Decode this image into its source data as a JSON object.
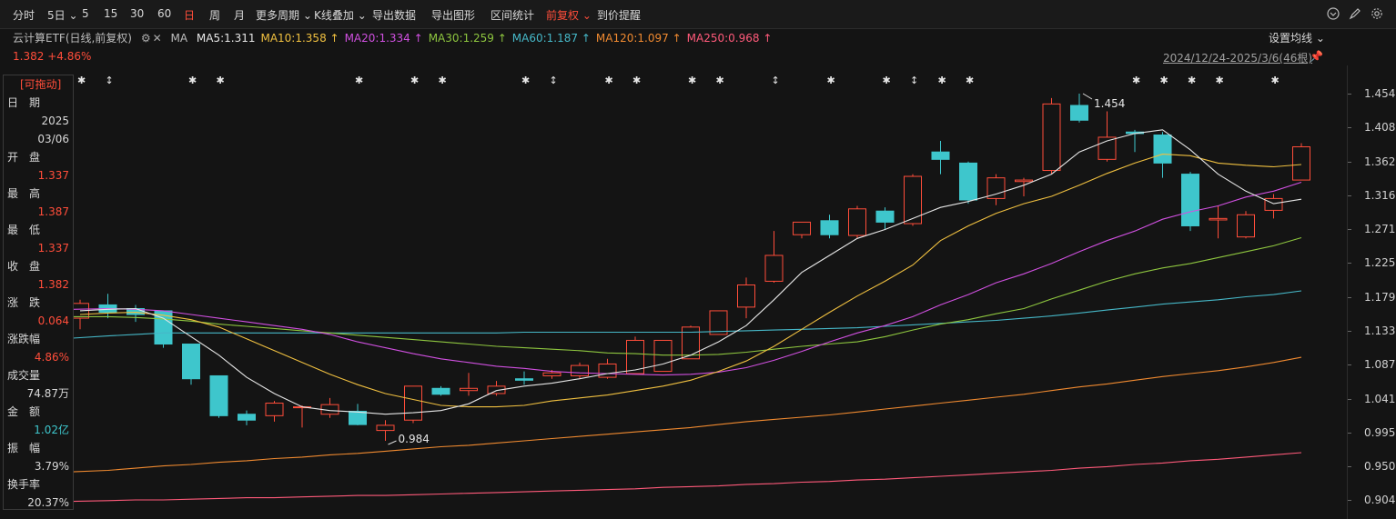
{
  "toolbar": {
    "items": [
      "分时",
      "5日",
      "5",
      "15",
      "30",
      "60",
      "日",
      "周",
      "月",
      "更多周期",
      "K线叠加",
      "导出数据",
      "导出图形",
      "区间统计",
      "前复权",
      "到价提醒"
    ],
    "active_period": "日",
    "adjust": "前复权"
  },
  "legend": {
    "title": "云计算ETF(日线,前复权)",
    "ma_label": "MA",
    "ma": [
      {
        "text": "MA5:1.311",
        "color": "#e6e6e6"
      },
      {
        "text": "MA10:1.358",
        "color": "#f0c040"
      },
      {
        "text": "MA20:1.334",
        "color": "#d050e0"
      },
      {
        "text": "MA30:1.259",
        "color": "#8ec63f"
      },
      {
        "text": "MA60:1.187",
        "color": "#46b8c8"
      },
      {
        "text": "MA120:1.097",
        "color": "#f08a30"
      },
      {
        "text": "MA250:0.968",
        "color": "#ff5a7a"
      }
    ],
    "settings": "设置均线",
    "price": "1.382",
    "change_pct": "+4.86%",
    "date_range": "2024/12/24-2025/3/6(46根)"
  },
  "info_panel": {
    "drag_label": "可拖动",
    "rows": [
      {
        "label": "日　期",
        "value": "2025"
      },
      {
        "label": "",
        "value": "03/06"
      },
      {
        "label": "开　盘",
        "value": "1.337"
      },
      {
        "label": "最　高",
        "value": "1.387"
      },
      {
        "label": "最　低",
        "value": "1.337"
      },
      {
        "label": "收　盘",
        "value": "1.382"
      },
      {
        "label": "涨　跌",
        "value": "0.064"
      },
      {
        "label": "涨跌幅",
        "value": "4.86%"
      },
      {
        "label": "成交量",
        "value": "74.87万"
      },
      {
        "label": "金　额",
        "value": "1.02亿"
      },
      {
        "label": "振　幅",
        "value": "3.79%"
      },
      {
        "label": "换手率",
        "value": "20.37%"
      }
    ]
  },
  "colors": {
    "up": "#ff4d3a",
    "down": "#3ec6cc",
    "bg": "#141414"
  },
  "chart_data": {
    "type": "candlestick",
    "y_ticks": [
      "1.454",
      "1.408",
      "1.362",
      "1.316",
      "1.271",
      "1.225",
      "1.179",
      "1.133",
      "1.087",
      "1.041",
      "0.995",
      "0.950",
      "0.904"
    ],
    "annotations": {
      "high": "1.454",
      "low": "0.984"
    },
    "candles": [
      {
        "o": 1.15,
        "h": 1.175,
        "l": 1.135,
        "c": 1.17
      },
      {
        "o": 1.168,
        "h": 1.183,
        "l": 1.15,
        "c": 1.158
      },
      {
        "o": 1.163,
        "h": 1.168,
        "l": 1.145,
        "c": 1.155
      },
      {
        "o": 1.16,
        "h": 1.16,
        "l": 1.11,
        "c": 1.115
      },
      {
        "o": 1.115,
        "h": 1.115,
        "l": 1.06,
        "c": 1.068
      },
      {
        "o": 1.072,
        "h": 1.072,
        "l": 1.015,
        "c": 1.018
      },
      {
        "o": 1.02,
        "h": 1.025,
        "l": 1.005,
        "c": 1.012
      },
      {
        "o": 1.018,
        "h": 1.038,
        "l": 1.01,
        "c": 1.035
      },
      {
        "o": 1.03,
        "h": 1.032,
        "l": 1.002,
        "c": 1.03
      },
      {
        "o": 1.02,
        "h": 1.042,
        "l": 1.015,
        "c": 1.033
      },
      {
        "o": 1.024,
        "h": 1.034,
        "l": 1.005,
        "c": 1.006
      },
      {
        "o": 0.998,
        "h": 1.012,
        "l": 0.984,
        "c": 1.005
      },
      {
        "o": 1.012,
        "h": 1.058,
        "l": 1.008,
        "c": 1.058
      },
      {
        "o": 1.055,
        "h": 1.058,
        "l": 1.045,
        "c": 1.047
      },
      {
        "o": 1.052,
        "h": 1.076,
        "l": 1.045,
        "c": 1.055
      },
      {
        "o": 1.048,
        "h": 1.065,
        "l": 1.045,
        "c": 1.058
      },
      {
        "o": 1.068,
        "h": 1.078,
        "l": 1.06,
        "c": 1.066
      },
      {
        "o": 1.072,
        "h": 1.08,
        "l": 1.068,
        "c": 1.076
      },
      {
        "o": 1.072,
        "h": 1.09,
        "l": 1.068,
        "c": 1.086
      },
      {
        "o": 1.07,
        "h": 1.095,
        "l": 1.068,
        "c": 1.088
      },
      {
        "o": 1.075,
        "h": 1.125,
        "l": 1.074,
        "c": 1.12
      },
      {
        "o": 1.078,
        "h": 1.12,
        "l": 1.078,
        "c": 1.12
      },
      {
        "o": 1.095,
        "h": 1.14,
        "l": 1.095,
        "c": 1.138
      },
      {
        "o": 1.128,
        "h": 1.16,
        "l": 1.128,
        "c": 1.16
      },
      {
        "o": 1.165,
        "h": 1.205,
        "l": 1.15,
        "c": 1.195
      },
      {
        "o": 1.2,
        "h": 1.268,
        "l": 1.198,
        "c": 1.235
      },
      {
        "o": 1.263,
        "h": 1.28,
        "l": 1.258,
        "c": 1.28
      },
      {
        "o": 1.282,
        "h": 1.29,
        "l": 1.258,
        "c": 1.263
      },
      {
        "o": 1.262,
        "h": 1.302,
        "l": 1.258,
        "c": 1.298
      },
      {
        "o": 1.295,
        "h": 1.3,
        "l": 1.27,
        "c": 1.28
      },
      {
        "o": 1.278,
        "h": 1.345,
        "l": 1.275,
        "c": 1.342
      },
      {
        "o": 1.375,
        "h": 1.39,
        "l": 1.345,
        "c": 1.365
      },
      {
        "o": 1.36,
        "h": 1.362,
        "l": 1.305,
        "c": 1.31
      },
      {
        "o": 1.312,
        "h": 1.345,
        "l": 1.303,
        "c": 1.34
      },
      {
        "o": 1.335,
        "h": 1.34,
        "l": 1.315,
        "c": 1.337
      },
      {
        "o": 1.35,
        "h": 1.448,
        "l": 1.345,
        "c": 1.44
      },
      {
        "o": 1.438,
        "h": 1.454,
        "l": 1.415,
        "c": 1.418
      },
      {
        "o": 1.365,
        "h": 1.43,
        "l": 1.362,
        "c": 1.395
      },
      {
        "o": 1.402,
        "h": 1.405,
        "l": 1.375,
        "c": 1.4
      },
      {
        "o": 1.398,
        "h": 1.402,
        "l": 1.34,
        "c": 1.36
      },
      {
        "o": 1.345,
        "h": 1.348,
        "l": 1.268,
        "c": 1.275
      },
      {
        "o": 1.283,
        "h": 1.302,
        "l": 1.258,
        "c": 1.285
      },
      {
        "o": 1.26,
        "h": 1.295,
        "l": 1.258,
        "c": 1.29
      },
      {
        "o": 1.296,
        "h": 1.318,
        "l": 1.285,
        "c": 1.312
      },
      {
        "o": 1.337,
        "h": 1.387,
        "l": 1.337,
        "c": 1.382
      }
    ],
    "ma5": [
      1.16,
      1.162,
      1.163,
      1.15,
      1.125,
      1.1,
      1.07,
      1.048,
      1.03,
      1.025,
      1.023,
      1.02,
      1.022,
      1.025,
      1.034,
      1.052,
      1.058,
      1.062,
      1.068,
      1.075,
      1.08,
      1.088,
      1.1,
      1.118,
      1.14,
      1.175,
      1.212,
      1.235,
      1.258,
      1.27,
      1.285,
      1.3,
      1.308,
      1.318,
      1.33,
      1.345,
      1.375,
      1.39,
      1.4,
      1.405,
      1.378,
      1.345,
      1.322,
      1.305,
      1.311
    ],
    "ma10": [
      1.155,
      1.157,
      1.158,
      1.154,
      1.148,
      1.138,
      1.122,
      1.106,
      1.09,
      1.074,
      1.06,
      1.048,
      1.04,
      1.032,
      1.03,
      1.03,
      1.032,
      1.038,
      1.042,
      1.046,
      1.052,
      1.058,
      1.066,
      1.078,
      1.092,
      1.112,
      1.135,
      1.158,
      1.18,
      1.2,
      1.222,
      1.255,
      1.275,
      1.292,
      1.305,
      1.315,
      1.33,
      1.346,
      1.36,
      1.372,
      1.37,
      1.36,
      1.357,
      1.355,
      1.358
    ],
    "ma20": [
      1.162,
      1.163,
      1.162,
      1.16,
      1.155,
      1.15,
      1.145,
      1.14,
      1.135,
      1.128,
      1.118,
      1.11,
      1.102,
      1.095,
      1.09,
      1.085,
      1.082,
      1.078,
      1.076,
      1.075,
      1.074,
      1.073,
      1.074,
      1.077,
      1.083,
      1.093,
      1.105,
      1.118,
      1.13,
      1.14,
      1.152,
      1.168,
      1.182,
      1.198,
      1.21,
      1.224,
      1.24,
      1.255,
      1.268,
      1.284,
      1.294,
      1.302,
      1.314,
      1.322,
      1.334
    ],
    "ma30": [
      1.152,
      1.152,
      1.151,
      1.149,
      1.146,
      1.142,
      1.139,
      1.136,
      1.133,
      1.13,
      1.127,
      1.124,
      1.121,
      1.118,
      1.115,
      1.112,
      1.11,
      1.108,
      1.106,
      1.103,
      1.102,
      1.1,
      1.1,
      1.101,
      1.104,
      1.108,
      1.112,
      1.115,
      1.118,
      1.125,
      1.134,
      1.142,
      1.148,
      1.156,
      1.163,
      1.176,
      1.188,
      1.2,
      1.21,
      1.218,
      1.224,
      1.232,
      1.24,
      1.248,
      1.259
    ],
    "ma60": [
      1.123,
      1.126,
      1.128,
      1.13,
      1.13,
      1.13,
      1.13,
      1.13,
      1.13,
      1.13,
      1.13,
      1.13,
      1.13,
      1.13,
      1.13,
      1.13,
      1.131,
      1.131,
      1.131,
      1.131,
      1.131,
      1.131,
      1.131,
      1.132,
      1.133,
      1.134,
      1.135,
      1.136,
      1.137,
      1.139,
      1.141,
      1.143,
      1.145,
      1.147,
      1.15,
      1.153,
      1.157,
      1.161,
      1.165,
      1.169,
      1.172,
      1.175,
      1.179,
      1.182,
      1.187
    ],
    "ma120": [
      0.942,
      0.944,
      0.947,
      0.95,
      0.952,
      0.955,
      0.957,
      0.96,
      0.962,
      0.965,
      0.967,
      0.97,
      0.973,
      0.976,
      0.978,
      0.981,
      0.984,
      0.987,
      0.99,
      0.993,
      0.996,
      0.999,
      1.002,
      1.006,
      1.01,
      1.013,
      1.016,
      1.019,
      1.023,
      1.027,
      1.031,
      1.035,
      1.039,
      1.043,
      1.047,
      1.052,
      1.057,
      1.061,
      1.066,
      1.071,
      1.075,
      1.079,
      1.084,
      1.09,
      1.097
    ],
    "ma250": [
      0.902,
      0.903,
      0.904,
      0.904,
      0.905,
      0.906,
      0.907,
      0.907,
      0.908,
      0.909,
      0.91,
      0.91,
      0.911,
      0.912,
      0.913,
      0.914,
      0.915,
      0.916,
      0.917,
      0.918,
      0.919,
      0.921,
      0.922,
      0.923,
      0.925,
      0.926,
      0.928,
      0.929,
      0.931,
      0.932,
      0.934,
      0.936,
      0.938,
      0.94,
      0.942,
      0.944,
      0.947,
      0.949,
      0.952,
      0.954,
      0.957,
      0.959,
      0.962,
      0.965,
      0.968
    ]
  }
}
